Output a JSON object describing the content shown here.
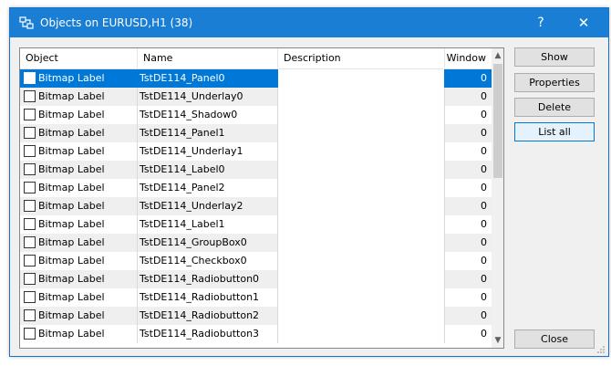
{
  "window": {
    "title": "Objects on EURUSD,H1 (38)",
    "help_label": "?",
    "close_label": "✕"
  },
  "table": {
    "columns": [
      "Object",
      "Name",
      "Description",
      "Window"
    ],
    "rows": [
      {
        "object": "Bitmap Label",
        "name": "TstDE114_Panel0",
        "description": "",
        "window": "0"
      },
      {
        "object": "Bitmap Label",
        "name": "TstDE114_Underlay0",
        "description": "",
        "window": "0"
      },
      {
        "object": "Bitmap Label",
        "name": "TstDE114_Shadow0",
        "description": "",
        "window": "0"
      },
      {
        "object": "Bitmap Label",
        "name": "TstDE114_Panel1",
        "description": "",
        "window": "0"
      },
      {
        "object": "Bitmap Label",
        "name": "TstDE114_Underlay1",
        "description": "",
        "window": "0"
      },
      {
        "object": "Bitmap Label",
        "name": "TstDE114_Label0",
        "description": "",
        "window": "0"
      },
      {
        "object": "Bitmap Label",
        "name": "TstDE114_Panel2",
        "description": "",
        "window": "0"
      },
      {
        "object": "Bitmap Label",
        "name": "TstDE114_Underlay2",
        "description": "",
        "window": "0"
      },
      {
        "object": "Bitmap Label",
        "name": "TstDE114_Label1",
        "description": "",
        "window": "0"
      },
      {
        "object": "Bitmap Label",
        "name": "TstDE114_GroupBox0",
        "description": "",
        "window": "0"
      },
      {
        "object": "Bitmap Label",
        "name": "TstDE114_Checkbox0",
        "description": "",
        "window": "0"
      },
      {
        "object": "Bitmap Label",
        "name": "TstDE114_Radiobutton0",
        "description": "",
        "window": "0"
      },
      {
        "object": "Bitmap Label",
        "name": "TstDE114_Radiobutton1",
        "description": "",
        "window": "0"
      },
      {
        "object": "Bitmap Label",
        "name": "TstDE114_Radiobutton2",
        "description": "",
        "window": "0"
      },
      {
        "object": "Bitmap Label",
        "name": "TstDE114_Radiobutton3",
        "description": "",
        "window": "0"
      }
    ]
  },
  "buttons": {
    "show": "Show",
    "properties": "Properties",
    "delete": "Delete",
    "list_all": "List all",
    "close": "Close"
  },
  "colors": {
    "titlebar": "#1a7fd4",
    "selection": "#0078d7"
  }
}
